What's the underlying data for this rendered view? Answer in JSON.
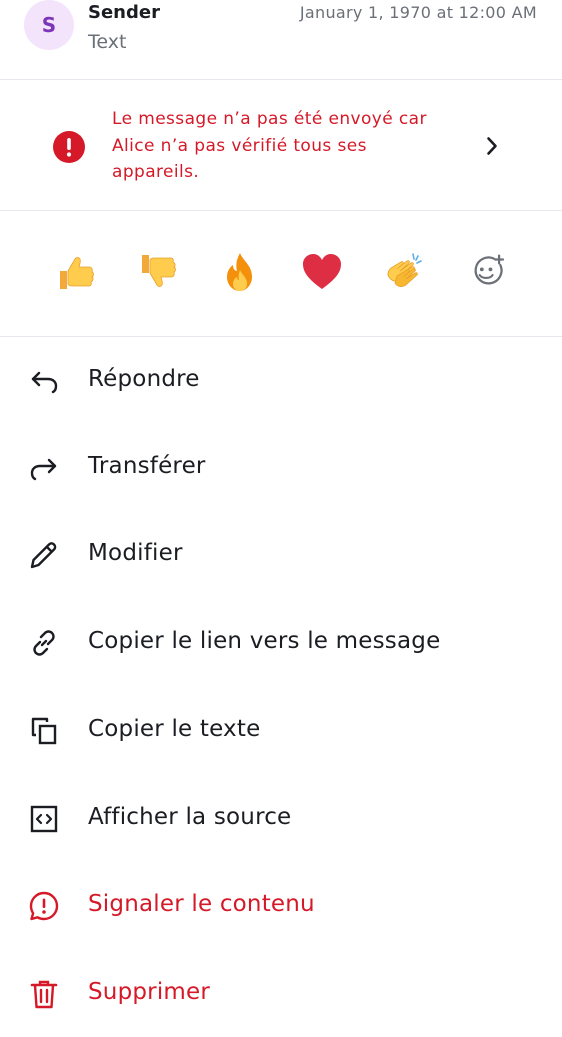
{
  "header": {
    "avatar_initial": "S",
    "sender_name": "Sender",
    "message_text": "Text",
    "timestamp": "January 1, 1970 at 12:00 AM"
  },
  "warning": {
    "line1": "Le message n’a pas été envoyé car",
    "line2": "Alice n’a pas vérifié tous ses",
    "line3": "appareils."
  },
  "reactions": [
    "thumbs-up",
    "thumbs-down",
    "fire",
    "red-heart",
    "clapping-hands",
    "add-reaction"
  ],
  "menu": {
    "reply": "Répondre",
    "forward": "Transférer",
    "edit": "Modifier",
    "copy_link": "Copier le lien vers le message",
    "copy_text": "Copier le texte",
    "view_source": "Afficher la source",
    "report": "Signaler le contenu",
    "delete": "Supprimer"
  },
  "colors": {
    "danger": "#d51928",
    "avatar_bg": "#f3e3fb",
    "avatar_fg": "#7c35b8",
    "divider": "#e6e8ee"
  }
}
